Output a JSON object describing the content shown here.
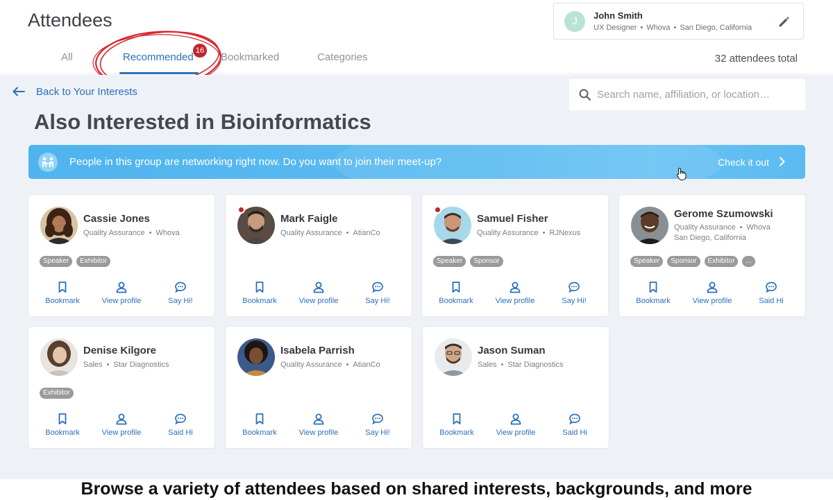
{
  "header": {
    "title": "Attendees",
    "tabs": [
      {
        "label": "All"
      },
      {
        "label": "Recommended",
        "badge": "16",
        "active": true
      },
      {
        "label": "Bookmarked"
      },
      {
        "label": "Categories"
      }
    ],
    "total": "32 attendees total",
    "user": {
      "initial": "J",
      "name": "John Smith",
      "role": "UX Designer",
      "company": "Whova",
      "location": "San Diego, California",
      "edit_icon": "pencil-icon"
    }
  },
  "main": {
    "back_label": "Back to Your Interests",
    "search_placeholder": "Search name, affiliation, or location…",
    "section_title": "Also Interested in Bioinformatics",
    "banner": {
      "text": "People in this group are networking right now. Do you want to join their meet-up?",
      "cta": "Check it out",
      "icon": "group-icon"
    }
  },
  "attendees": [
    {
      "name": "Cassie Jones",
      "role": "Quality Assurance",
      "company": "Whova",
      "location": "",
      "tags": [
        "Speaker",
        "Exhibitor"
      ],
      "online": false,
      "actions": [
        "Bookmark",
        "View profile",
        "Say Hi!"
      ]
    },
    {
      "name": "Mark Faigle",
      "role": "Quality Assurance",
      "company": "AtianCo",
      "location": "",
      "tags": [],
      "online": true,
      "actions": [
        "Bookmark",
        "View profile",
        "Say Hi!"
      ]
    },
    {
      "name": "Samuel Fisher",
      "role": "Quality Assurance",
      "company": "RJNexus",
      "location": "",
      "tags": [
        "Speaker",
        "Sponsor"
      ],
      "online": true,
      "actions": [
        "Bookmark",
        "View profile",
        "Say Hi!"
      ]
    },
    {
      "name": "Gerome Szumowski",
      "role": "Quality Assurance",
      "company": "Whova",
      "location": "San Diego, California",
      "tags": [
        "Speaker",
        "Sponsor",
        "Exhibitor",
        "..."
      ],
      "online": false,
      "actions": [
        "Bookmark",
        "View profile",
        "Said Hi"
      ]
    },
    {
      "name": "Denise Kilgore",
      "role": "Sales",
      "company": "Star Diagnostics",
      "location": "",
      "tags": [
        "Exhibitor"
      ],
      "online": false,
      "actions": [
        "Bookmark",
        "View profile",
        "Said Hi"
      ]
    },
    {
      "name": "Isabela Parrish",
      "role": "Quality Assurance",
      "company": "AtianCo",
      "location": "",
      "tags": [],
      "online": false,
      "actions": [
        "Bookmark",
        "View profile",
        "Say Hi!"
      ]
    },
    {
      "name": "Jason Suman",
      "role": "Sales",
      "company": "Star Diagnostics",
      "location": "",
      "tags": [],
      "online": false,
      "actions": [
        "Bookmark",
        "View profile",
        "Said Hi"
      ]
    }
  ],
  "caption": "Browse a variety of attendees based on shared interests, backgrounds, and more",
  "colors": {
    "accent": "#2c6fb9",
    "badge": "#c0262c",
    "banner": "#5bbaf0",
    "tag": "#9a9a9a"
  }
}
